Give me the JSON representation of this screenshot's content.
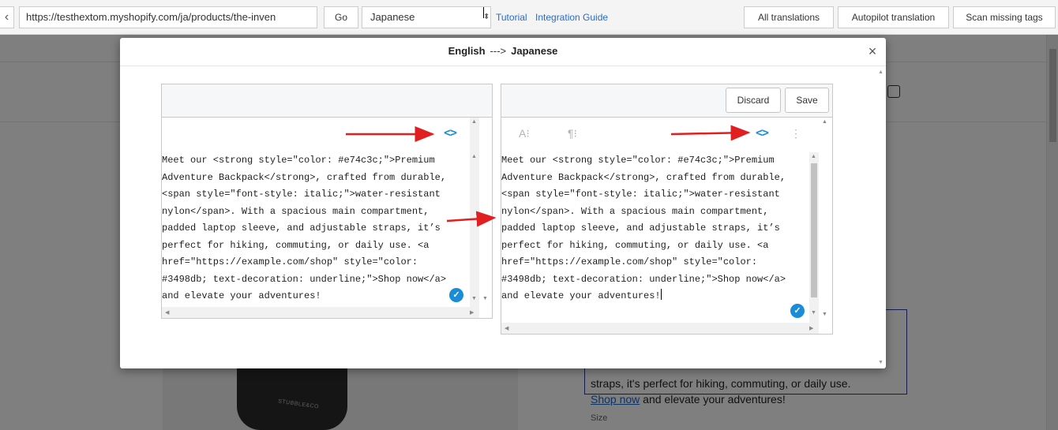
{
  "toolbar": {
    "back_glyph": "‹",
    "url": "https://testhextom.myshopify.com/ja/products/the-inven",
    "go_label": "Go",
    "language_select": "Japanese",
    "tutorial_link": "Tutorial",
    "guide_link": "Integration Guide",
    "all_translations_label": "All translations",
    "autopilot_label": "Autopilot translation",
    "scan_label": "Scan missing tags"
  },
  "background": {
    "desc_text": "straps, it's perfect for hiking, commuting, or daily use.",
    "link_text": "Shop now",
    "after_link_text": " and elevate your adventures!",
    "size_label": "Size",
    "bag_brand": "STUBBLE&CO"
  },
  "modal": {
    "source_lang": "English",
    "separator": "--->",
    "target_lang": "Japanese",
    "close_glyph": "×",
    "left_pane": {
      "code_icon": "<>",
      "content": "Meet our <strong style=\"color: #e74c3c;\">Premium\nAdventure Backpack</strong>, crafted from durable,\n<span style=\"font-style: italic;\">water-resistant\nnylon</span>. With a spacious main compartment,\npadded laptop sleeve, and adjustable straps, it’s\nperfect for hiking, commuting, or daily use. <a\nhref=\"https://example.com/shop\" style=\"color:\n#3498db; text-decoration: underline;\">Shop now</a>\nand elevate your adventures!"
    },
    "right_pane": {
      "discard_label": "Discard",
      "save_label": "Save",
      "font_icon": "A⁝",
      "paragraph_icon": "¶⁝",
      "code_icon": "<>",
      "more_icon": "⋮",
      "content": "Meet our <strong style=\"color: #e74c3c;\">Premium\nAdventure Backpack</strong>, crafted from durable,\n<span style=\"font-style: italic;\">water-resistant\nnylon</span>. With a spacious main compartment,\npadded laptop sleeve, and adjustable straps, it’s\nperfect for hiking, commuting, or daily use. <a\nhref=\"https://example.com/shop\" style=\"color:\n#3498db; text-decoration: underline;\">Shop now</a>\nand elevate your adventures!"
    },
    "check_glyph": "✓"
  },
  "colors": {
    "accent": "#1a8cd8",
    "annotation_arrow": "#e02020",
    "link": "#2a6bc9"
  }
}
